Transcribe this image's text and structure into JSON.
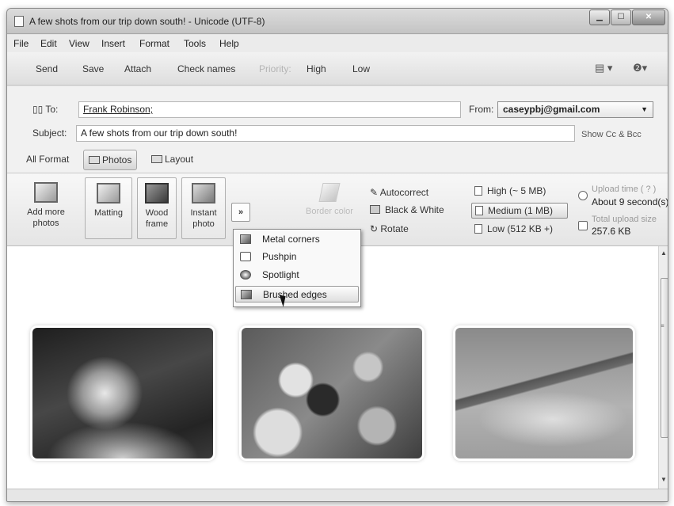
{
  "window": {
    "title": "A few shots from our trip down south! - Unicode (UTF-8)"
  },
  "menu": [
    "File",
    "Edit",
    "View",
    "Insert",
    "Format",
    "Tools",
    "Help"
  ],
  "toolbar": {
    "send": "Send",
    "save": "Save",
    "attach": "Attach",
    "check_names": "Check names",
    "priority": "Priority:",
    "high": "High",
    "low": "Low",
    "right_icons": [
      "document-icon",
      "help-icon"
    ]
  },
  "header": {
    "to_label": "To:",
    "to_value": "Frank Robinson;",
    "from_label": "From:",
    "from_value": "caseypbj@gmail.com",
    "subject_label": "Subject:",
    "subject_value": "A few shots from our trip down south!",
    "show_cc": "Show Cc & Bcc",
    "tabs": [
      "Format",
      "Photos",
      "Layout"
    ],
    "active_tab": "Photos"
  },
  "ribbon": {
    "add_more": [
      "Add more",
      "photos"
    ],
    "matting": "Matting",
    "wood_frame": [
      "Wood",
      "frame"
    ],
    "instant_photo": [
      "Instant",
      "photo"
    ],
    "more": "»",
    "border_color": "Border color",
    "options": [
      "Autocorrect",
      "Black & White",
      "Rotate"
    ],
    "sizes": [
      "High (~ 5 MB)",
      "Medium (1 MB)",
      "Low (512 KB +)"
    ],
    "selected_size": "Medium (1 MB)",
    "upload_time_label": "Upload time ( ? )",
    "upload_time_value": "About 9 second(s)",
    "total_size_label": "Total upload size",
    "total_size_value": "257.6 KB"
  },
  "dropdown": {
    "items": [
      "Metal corners",
      "Pushpin",
      "Spotlight",
      "Brushed edges"
    ],
    "hover": "Brushed edges"
  },
  "photos": [
    "waterfall-photo",
    "flower-photo",
    "airplane-wing-photo"
  ]
}
